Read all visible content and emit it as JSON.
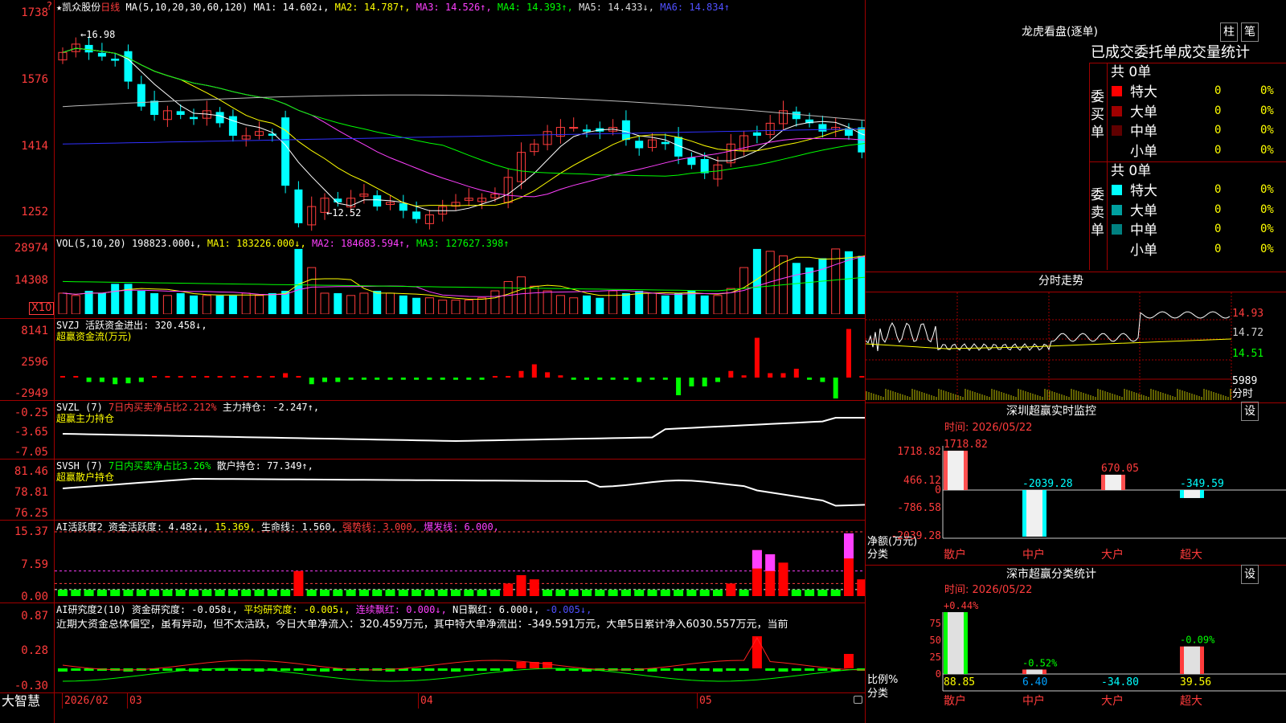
{
  "header": {
    "help_icon": "?",
    "stock_name": "★凯众股份",
    "period": "日线",
    "ma_label": "MA(5,10,20,30,60,120)",
    "ma1": "MA1: 14.602↓,",
    "ma2": "MA2: 14.787↑,",
    "ma3": "MA3: 14.526↑,",
    "ma4": "MA4: 14.393↑,",
    "ma5": "MA5: 14.433↓,",
    "ma6": "MA6: 14.834↑"
  },
  "main_axis": [
    "1738",
    "1576",
    "1414",
    "1252"
  ],
  "annotations": {
    "high": "16.98",
    "low": "12.52"
  },
  "vol": {
    "label": "VOL(5,10,20)",
    "value": "198823.000↓,",
    "ma1": "MA1: 183226.000↓,",
    "ma2": "MA2: 184683.594↑,",
    "ma3": "MA3: 127627.398↑",
    "axis": [
      "28974",
      "14308"
    ],
    "unit": "X10"
  },
  "svzj": {
    "label": "SVZJ  活跃资金进出: 320.458↓,",
    "sub": "超赢资金流(万元)",
    "axis": [
      "8141",
      "2596",
      "-2949"
    ]
  },
  "svzl": {
    "label": "SVZL (7)",
    "part2": "7日内买卖净占比2.212%",
    "part3": "主力持仓: -2.247↑,",
    "sub": "超赢主力持仓",
    "axis": [
      "-0.25",
      "-3.65",
      "-7.05"
    ]
  },
  "svsh": {
    "label": "SVSH (7)",
    "part2": "7日内买卖净占比3.26%",
    "part3": "散户持仓: 77.349↑,",
    "sub": "超赢散户持仓",
    "axis": [
      "81.46",
      "78.81",
      "76.25"
    ]
  },
  "ai1": {
    "label": "AI活跃度2",
    "p1": "资金活跃度: 4.482↓,",
    "p2": "15.369,",
    "p3": "生命线: 1.560,",
    "p4": "强势线: 3.000,",
    "p5": "爆发线: 6.000,",
    "axis": [
      "15.37",
      "7.59",
      "0.00"
    ]
  },
  "ai2": {
    "label": "AI研究度2(10)",
    "p1": "资金研究度: -0.058↓,",
    "p2": "平均研究度: -0.005↓,",
    "p3": "连续飘红: 0.000↓,",
    "p4": "N日飘红: 6.000↓,",
    "p5": "-0.005↓,",
    "desc": "近期大资金总体偏空，虽有异动，但不太活跃，今日大单净流入：320.459万元，其中特大单净流出：-349.591万元，大单5日累计净入6030.557万元，当前",
    "axis": [
      "0.87",
      "0.28",
      "-0.30"
    ]
  },
  "xaxis": {
    "brand": "大智慧",
    "labels": [
      "2026/02",
      "03",
      "04",
      "05"
    ]
  },
  "right": {
    "lhb_title": "龙虎看盘(逐单)",
    "btn_zhu": "柱",
    "btn_bi": "笔",
    "stats_title": "已成交委托单成交量统计",
    "buy_label": "委买单",
    "sell_label": "委卖单",
    "buy_total": "共 0单",
    "sell_total": "共 0单",
    "buy_rows": [
      {
        "name": "特大",
        "count": "0",
        "pct": "0%",
        "color": "#ff0000"
      },
      {
        "name": "大单",
        "count": "0",
        "pct": "0%",
        "color": "#a00000"
      },
      {
        "name": "中单",
        "count": "0",
        "pct": "0%",
        "color": "#600000"
      },
      {
        "name": "小单",
        "count": "0",
        "pct": "0%",
        "color": ""
      }
    ],
    "sell_rows": [
      {
        "name": "特大",
        "count": "0",
        "pct": "0%",
        "color": "#00ffff"
      },
      {
        "name": "大单",
        "count": "0",
        "pct": "0%",
        "color": "#00a0a0"
      },
      {
        "name": "中单",
        "count": "0",
        "pct": "0%",
        "color": "#008080"
      },
      {
        "name": "小单",
        "count": "0",
        "pct": "0%",
        "color": ""
      }
    ],
    "intraday_title": "分时走势",
    "intraday_axis": [
      "14.93",
      "14.72",
      "14.51"
    ],
    "intraday_vol": "5989",
    "intraday_unit": "分时",
    "monitor_title": "深圳超赢实时监控",
    "settings": "设",
    "monitor_time": "时间: 2026/05/22",
    "monitor_axis": [
      "1718.82",
      "466.12",
      "0",
      "-786.58",
      "-2039.28"
    ],
    "monitor_ylabel": "净额(万元)",
    "monitor_xlabel": "分类",
    "monitor_cats": [
      "散户",
      "中户",
      "大户",
      "超大"
    ],
    "monitor_values": [
      "1718.82",
      "-2039.28",
      "670.05",
      "-349.59"
    ],
    "class_title": "深市超赢分类统计",
    "class_time": "时间: 2026/05/22",
    "class_axis": [
      "75",
      "50",
      "25",
      "0"
    ],
    "class_ylabel": "比例%",
    "class_xlabel": "分类",
    "class_top": [
      "+0.44%",
      "-0.52%",
      "",
      "-0.09%"
    ],
    "class_cats": [
      "散户",
      "中户",
      "大户",
      "超大"
    ],
    "class_values": [
      "88.85",
      "6.40",
      "-34.80",
      "39.56"
    ]
  },
  "chart_data": [
    {
      "type": "candlestick",
      "title": "凯众股份 日线",
      "ylim": [
        12.52,
        17.38
      ],
      "closes": [
        16.7,
        16.9,
        16.7,
        16.6,
        16.5,
        16.0,
        15.4,
        15.2,
        15.3,
        15.2,
        15.1,
        15.3,
        15.0,
        14.7,
        14.7,
        14.8,
        14.7,
        13.5,
        12.6,
        13.0,
        13.2,
        13.1,
        13.2,
        13.3,
        13.0,
        13.1,
        12.9,
        12.7,
        12.8,
        13.0,
        13.1,
        13.2,
        13.2,
        13.3,
        13.7,
        14.3,
        14.5,
        14.8,
        14.9,
        14.9,
        14.8,
        14.8,
        14.9,
        14.6,
        14.4,
        14.6,
        14.5,
        14.2,
        14.0,
        13.8,
        14.0,
        14.5,
        14.7,
        14.7,
        15.0,
        15.3,
        15.1,
        15.0,
        14.8,
        14.9,
        14.7,
        14.3,
        14.5
      ]
    },
    {
      "type": "bar",
      "title": "VOL(5,10,20)",
      "values": [
        9,
        8,
        10,
        9,
        13,
        13,
        10,
        9,
        8,
        9,
        8,
        8,
        8,
        8,
        9,
        8,
        9,
        10,
        28,
        20,
        9,
        9,
        8,
        9,
        10,
        9,
        8,
        7,
        7,
        6,
        6,
        6,
        7,
        10,
        14,
        16,
        12,
        10,
        8,
        7,
        8,
        7,
        10,
        9,
        10,
        9,
        8,
        9,
        10,
        8,
        8,
        11,
        20,
        28,
        27,
        25,
        22,
        20,
        24,
        28,
        27,
        25,
        26
      ]
    },
    {
      "type": "bar",
      "title": "AI活跃度2",
      "ylim": [
        0,
        15.37
      ],
      "values": [
        1,
        1,
        1,
        1,
        1,
        1,
        1,
        1,
        1,
        1,
        1,
        1,
        1,
        1,
        1,
        1,
        1,
        1,
        6,
        1,
        1,
        1,
        1,
        1,
        1,
        1,
        1,
        1,
        1,
        1,
        1,
        1,
        1,
        1,
        3,
        5,
        4,
        1,
        1,
        1,
        1,
        1,
        1,
        1,
        1,
        1,
        1,
        1,
        1,
        1,
        1,
        3,
        1,
        11,
        10,
        8,
        1,
        1,
        1,
        1,
        15,
        4,
        1
      ]
    }
  ]
}
